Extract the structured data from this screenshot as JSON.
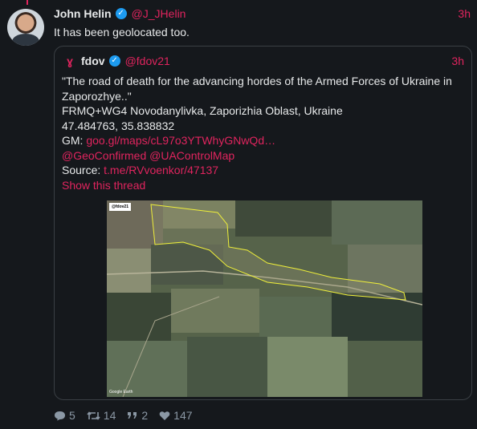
{
  "tweet": {
    "author_name": "John Helin",
    "author_handle": "@J_JHelin",
    "time": "3h",
    "text": "It has been geolocated too."
  },
  "quote": {
    "author_name": "fdov",
    "author_handle": "@fdov21",
    "time": "3h",
    "lines": {
      "l1": "\"The road of death for the advancing hordes of the Armed Forces of Ukraine in Zaporozhye..\"",
      "l2": "FRMQ+WG4 Novodanylivka, Zaporizhia Oblast, Ukraine",
      "l3": "47.484763, 35.838832",
      "gm_label": "GM:",
      "gm_link": "goo.gl/maps/cL97o3YTWhyGNwQd…",
      "mentions": "@GeoConfirmed @UAControlMap",
      "source_label": "Source:",
      "source_link": "t.me/RVvoenkor/47137"
    },
    "show_thread": "Show this thread",
    "image": {
      "tag": "@fdov21",
      "attribution": "Google Earth"
    }
  },
  "actions": {
    "replies": "5",
    "retweets": "14",
    "quotes": "2",
    "likes": "147"
  },
  "colors": {
    "accent": "#e0245e",
    "verified": "#1d9bf0",
    "background": "#15181c",
    "outline": "#f0f03a"
  }
}
